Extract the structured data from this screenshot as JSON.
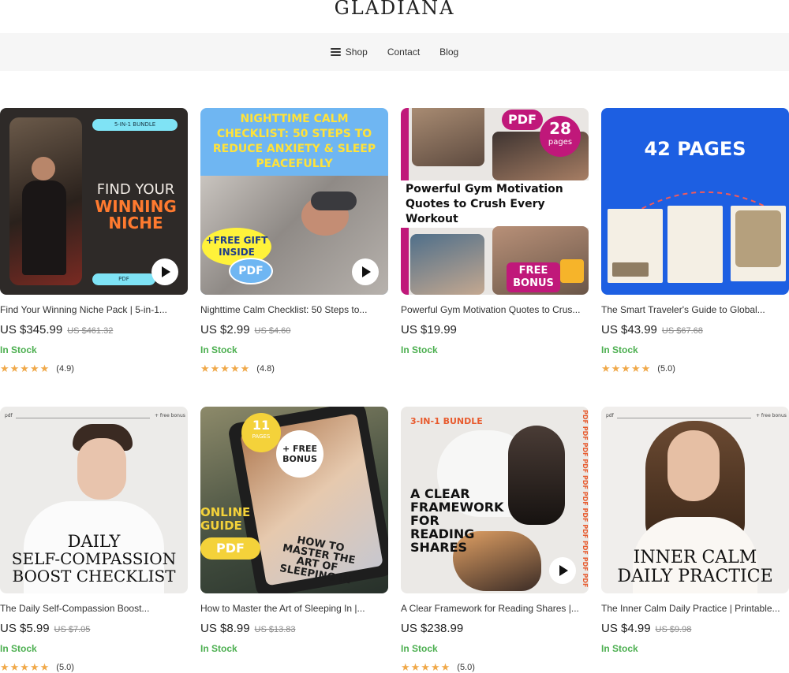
{
  "brand": {
    "name": "GLADIANA"
  },
  "nav": {
    "shop": "Shop",
    "contact": "Contact",
    "blog": "Blog"
  },
  "products": [
    {
      "title": "Find Your Winning Niche Pack | 5-in-1...",
      "price": "US $345.99",
      "old_price": "US $461.32",
      "stock": "In Stock",
      "rating": "(4.9)",
      "stars": 5,
      "image_text": {
        "badge": "5-IN-1 BUNDLE",
        "line1": "FIND YOUR",
        "line2": "WINNING",
        "line3": "NICHE",
        "footer": "PDF"
      }
    },
    {
      "title": "Nighttime Calm Checklist: 50 Steps to...",
      "price": "US $2.99",
      "old_price": "US $4.60",
      "stock": "In Stock",
      "rating": "(4.8)",
      "stars": 5,
      "image_text": {
        "headline": "NIGHTTIME CALM CHECKLIST: 50 STEPS TO REDUCE ANXIETY & SLEEP PEACEFULLY",
        "gift": "+FREE GIFT INSIDE",
        "pdf": "PDF"
      }
    },
    {
      "title": "Powerful Gym Motivation Quotes to Crus...",
      "price": "US $19.99",
      "old_price": "",
      "stock": "In Stock",
      "rating": "",
      "stars": 0,
      "image_text": {
        "pdf": "PDF",
        "pages_num": "28",
        "pages": "pages",
        "headline": "Powerful Gym Motivation Quotes to Crush Every Workout",
        "bonus": "FREE BONUS"
      }
    },
    {
      "title": "The Smart Traveler's Guide to Global...",
      "price": "US $43.99",
      "old_price": "US $67.68",
      "stock": "In Stock",
      "rating": "(5.0)",
      "stars": 5,
      "image_text": {
        "headline": "42 PAGES"
      }
    },
    {
      "title": "The Daily Self-Compassion Boost...",
      "price": "US $5.99",
      "old_price": "US $7.05",
      "stock": "In Stock",
      "rating": "(5.0)",
      "stars": 5,
      "image_text": {
        "tag_left": "pdf",
        "tag_right": "+ free bonus",
        "line1": "DAILY",
        "line2": "SELF-COMPASSION",
        "line3": "BOOST CHECKLIST"
      }
    },
    {
      "title": "How to Master the Art of Sleeping In |...",
      "price": "US $8.99",
      "old_price": "US $13.83",
      "stock": "In Stock",
      "rating": "",
      "stars": 0,
      "image_text": {
        "pages_num": "11",
        "pages": "PAGES",
        "bonus": "+ FREE BONUS",
        "guide1": "ONLINE",
        "guide2": "GUIDE",
        "pdf": "PDF",
        "book": "HOW TO MASTER THE ART OF SLEEPING IN"
      }
    },
    {
      "title": "A Clear Framework for Reading Shares |...",
      "price": "US $238.99",
      "old_price": "",
      "stock": "In Stock",
      "rating": "(5.0)",
      "stars": 5,
      "image_text": {
        "bundle": "3-IN-1 BUNDLE",
        "line1": "A CLEAR",
        "line2": "FRAMEWORK",
        "line3": "FOR",
        "line4": "READING",
        "line5": "SHARES",
        "side": "PDF PDF PDF PDF PDF PDF PDF PDF PDF PDF PDF"
      }
    },
    {
      "title": "The Inner Calm Daily Practice | Printable...",
      "price": "US $4.99",
      "old_price": "US $9.98",
      "stock": "In Stock",
      "rating": "",
      "stars": 0,
      "image_text": {
        "tag_left": "pdf",
        "tag_right": "+ free bonus",
        "line1": "INNER CALM",
        "line2": "DAILY PRACTICE"
      }
    }
  ]
}
